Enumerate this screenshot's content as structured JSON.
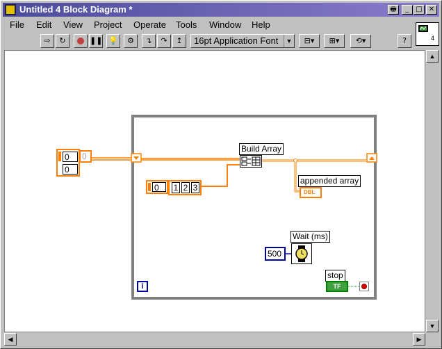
{
  "window": {
    "title": "Untitled 4 Block Diagram *"
  },
  "title_buttons": {
    "print": "🖶",
    "minimize": "_",
    "maximize": "□",
    "close": "✕"
  },
  "menu": [
    "File",
    "Edit",
    "View",
    "Project",
    "Operate",
    "Tools",
    "Window",
    "Help"
  ],
  "toolbar": {
    "font": "16pt Application Font",
    "help": "?"
  },
  "vi_icon_number": "4",
  "diagram": {
    "array_const_a": "0",
    "array_const_b": "0",
    "index_const": "0",
    "array_index": "0",
    "array_values": [
      "1",
      "2",
      "3"
    ],
    "build_array_label": "Build Array",
    "indicator_label": "appended array",
    "indicator_type": "DBL",
    "wait_label": "Wait (ms)",
    "wait_value": "500",
    "stop_label": "stop",
    "stop_type": "TF",
    "loop_index": "i"
  },
  "colors": {
    "wire_double": "#ff8000",
    "wire_bool": "#008000",
    "wire_int": "#0000a0",
    "loop_border": "#808080"
  }
}
